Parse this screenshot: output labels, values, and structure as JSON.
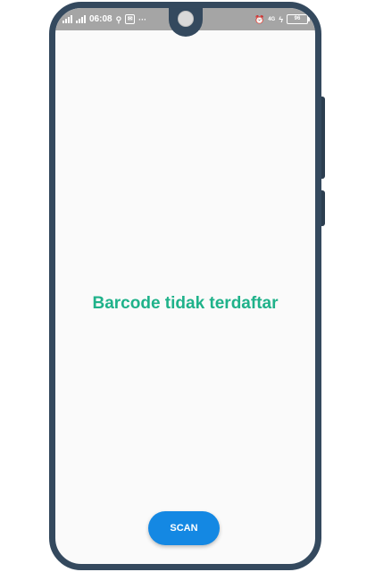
{
  "status_bar": {
    "time": "06:08",
    "left_icons": [
      "signal-icon",
      "signal-4g-icon",
      "usb-icon",
      "notification-app-icon",
      "more-icon"
    ],
    "more_label": "···",
    "alarm_label": "⏰",
    "network_label": "4G",
    "battery_level": "96",
    "right_icons": [
      "alarm-icon",
      "network-speed-icon",
      "charging-icon",
      "battery-icon"
    ]
  },
  "main": {
    "message": "Barcode tidak terdaftar"
  },
  "actions": {
    "scan_label": "SCAN"
  },
  "colors": {
    "frame": "#34495e",
    "status_bar": "#a5a5a5",
    "message": "#1fb28a",
    "scan_button": "#1488e3",
    "screen": "#fafafa"
  }
}
